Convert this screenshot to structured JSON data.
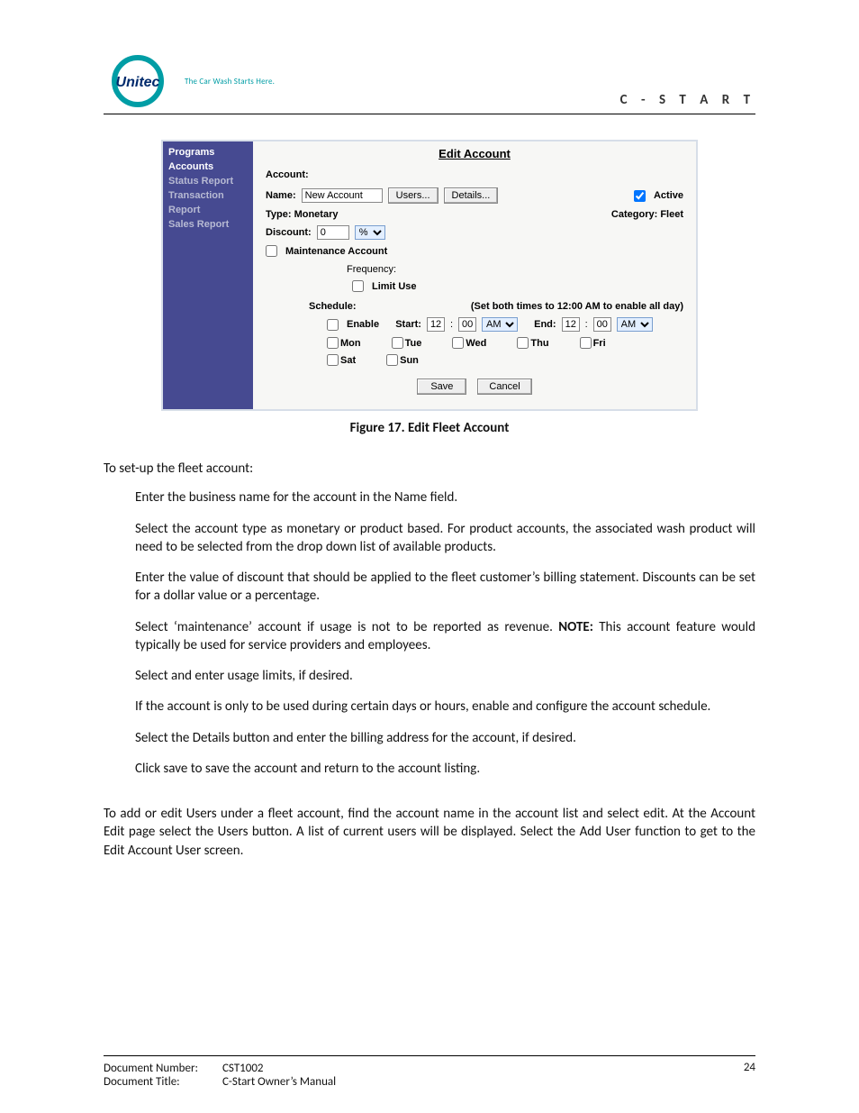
{
  "header": {
    "tagline": "The Car Wash Starts Here.",
    "brand": "C - S T A R T"
  },
  "app": {
    "nav": {
      "programs": "Programs",
      "accounts": "Accounts",
      "status": "Status Report",
      "trans1": "Transaction",
      "trans2": "Report",
      "sales": "Sales Report"
    },
    "title": "Edit Account",
    "section_account": "Account:",
    "name_label": "Name:",
    "name_value": "New Account",
    "users_btn": "Users...",
    "details_btn": "Details...",
    "active_label": "Active",
    "type_label": "Type: Monetary",
    "category_label": "Category: Fleet",
    "discount_label": "Discount:",
    "discount_value": "0",
    "discount_unit": "%",
    "maint_label": "Maintenance Account",
    "freq_label": "Frequency:",
    "limit_label": "Limit Use",
    "schedule_label": "Schedule:",
    "schedule_hint": "(Set both times to 12:00 AM to enable all day)",
    "enable_label": "Enable",
    "start_label": "Start:",
    "end_label": "End:",
    "time_hh": "12",
    "time_mm": "00",
    "ampm": "AM",
    "days": {
      "mon": "Mon",
      "tue": "Tue",
      "wed": "Wed",
      "thu": "Thu",
      "fri": "Fri",
      "sat": "Sat",
      "sun": "Sun"
    },
    "save_btn": "Save",
    "cancel_btn": "Cancel"
  },
  "figure_caption": "Figure 17. Edit Fleet Account",
  "paragraphs": {
    "lead": "To set-up the fleet account:",
    "s1": "Enter the business name for the account in the Name field.",
    "s2": "Select the account type as monetary or product based. For product accounts, the associated wash product will need to be selected from the drop down list of available products.",
    "s3": "Enter the value of discount that should be applied to the fleet customer’s billing statement. Discounts can be set for a dollar value or a percentage.",
    "s4a": "Select ‘maintenance’ account if usage is not to be reported as revenue. ",
    "note": "NOTE:",
    "s4b": " This account feature would typically be used for service providers and employees.",
    "s5": "Select and enter usage limits, if desired.",
    "s6": "If the account is only to be used during certain days or hours, enable and configure the account schedule.",
    "s7": "Select the Details button and enter the billing address for the account, if desired.",
    "s8": "Click save to save the account and return to the account listing.",
    "final": "To add or edit Users under a fleet account, find the account name in the account list and select edit. At the Account Edit page select the Users button. A list of current users will be displayed. Select the Add User function to get to the Edit Account User screen."
  },
  "footer": {
    "docnum_k": "Document Number:",
    "docnum_v": "CST1002",
    "doctitle_k": "Document Title:",
    "doctitle_v": "C-Start Owner’s Manual",
    "page": "24"
  }
}
